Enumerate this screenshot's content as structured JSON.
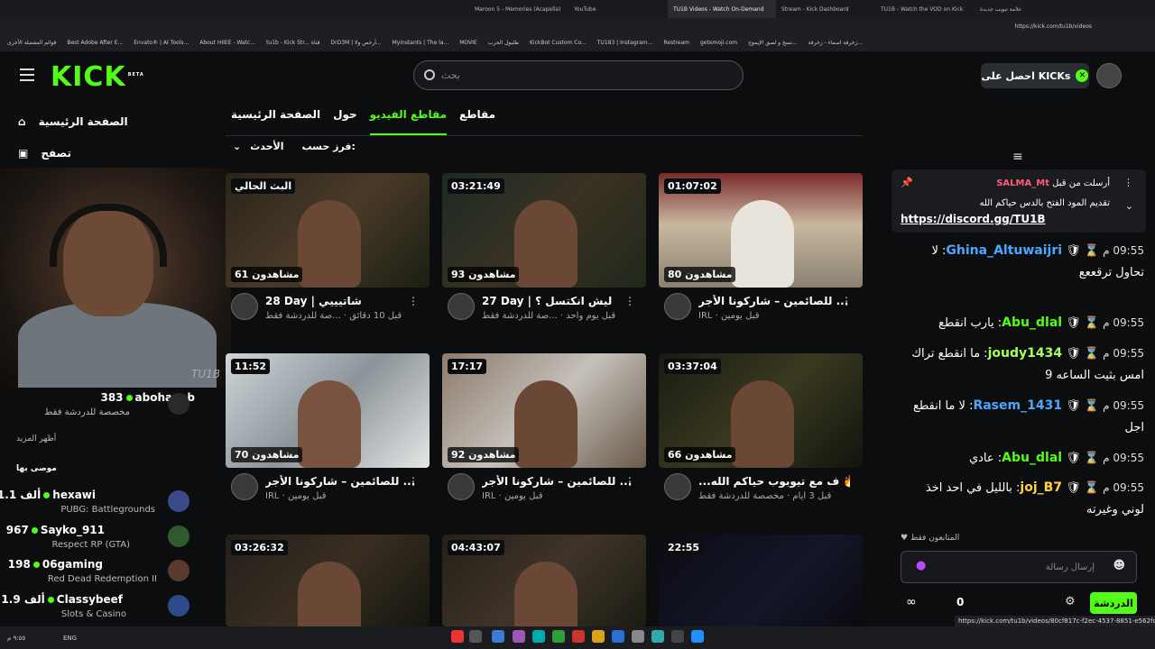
{
  "browser": {
    "tabs": [
      "Maroon 5 - Memories (Acapella)",
      "YouTube",
      "TU1B Videos - Watch On-Demand",
      "Stream - Kick Dashboard",
      "TU1B - Watch the VOD on Kick",
      "علامة تبويب جديدة"
    ],
    "url": "https://kick.com/tu1b/videos",
    "bookmarks": [
      "قوائم المفضلة الأخرى",
      "Best Adobe After E...",
      "Envato® | AI Tools...",
      "About HIIEE - Watc...",
      "tu1b - Kick Str... قناة",
      "DrD3M | أرخص ولا...",
      "Myinstants | The la...",
      "MOVIE",
      "طليول الحرب",
      "KickBot Custom Co...",
      "TU183 | Instagram...",
      "Restream",
      "getemoji.com",
      "نسخ و لصق الإيموج...",
      "زخرفة اسماء - زخرفة..."
    ]
  },
  "header": {
    "logo": "KICK",
    "logo_badge": "BETA",
    "search_placeholder": "بحث",
    "get_kicks": "احصل على KICKs"
  },
  "sidebar": {
    "nav": [
      "الصفحة الرئيسية",
      "تصفح"
    ],
    "stream_label": "TU1B",
    "current": {
      "name": "abohaeeb",
      "count": "383",
      "category": "مخصصة للدردشة فقط"
    },
    "show_more": "أظهر المزيد",
    "recommended_label": "موصى بها",
    "channels": [
      {
        "name": "hexawi",
        "count": "1.1 ألف",
        "category": "PUBG: Battlegrounds"
      },
      {
        "name": "Sayko_911",
        "count": "967",
        "category": "Respect RP (GTA)"
      },
      {
        "name": "06gaming",
        "count": "198",
        "category": "Red Dead Redemption II"
      },
      {
        "name": "Classybeef",
        "count": "1.9 ألف",
        "category": "Slots & Casino"
      }
    ]
  },
  "main": {
    "tabs": [
      "الصفحة الرئيسية",
      "حول",
      "مقاطع الفيديو",
      "مقاطع"
    ],
    "sort_label": "فرز حسب:",
    "sort_value": "الأحدث",
    "videos": [
      {
        "duration": "البث الحالي",
        "views": "61 مشاهدون",
        "title": "28 Day | شاتيييي",
        "sub": "قبل 10 دقائق · ...صة للدردشة فقط"
      },
      {
        "duration": "03:21:49",
        "views": "93 مشاهدون",
        "title": "27 Day | ليش انكتسل ؟",
        "sub": "قبل يوم واحد · ...صة للدردشة فقط"
      },
      {
        "duration": "01:07:02",
        "views": "80 مشاهدون",
        "title": "للصائمين – شاركونا الأجر ...",
        "sub": "IRL · قبل يومين"
      },
      {
        "duration": "11:52",
        "views": "70 مشاهدون",
        "title": "للصائمين – شاركونا الأجر ...",
        "sub": "IRL · قبل يومين"
      },
      {
        "duration": "17:17",
        "views": "92 مشاهدون",
        "title": "للصائمين – شاركونا الأجر ...",
        "sub": "IRL · قبل يومين"
      },
      {
        "duration": "03:37:04",
        "views": "66 مشاهدون",
        "title": "...ف مع تيوبوب حياكم الله 🔥",
        "sub": "قبل 3 أيام · مخصصة للدردشة فقط"
      },
      {
        "duration": "03:26:32",
        "views": "",
        "title": "",
        "sub": ""
      },
      {
        "duration": "04:43:07",
        "views": "",
        "title": "",
        "sub": ""
      },
      {
        "duration": "22:55",
        "views": "",
        "title": "",
        "sub": ""
      }
    ]
  },
  "chat": {
    "pinned_user": "SALMA_Mt",
    "pinned_by": "أرسلت من قبل",
    "pinned_text": "تقديم المود الفتح بالدس حياكم الله",
    "pinned_link": "https://discord.gg/TU1B",
    "messages": [
      {
        "time": "09:55 م",
        "user": "Ghina_Altuwaijri",
        "color": "#4aa8ff",
        "text": "لا تحاول ترقععع"
      },
      {
        "time": "09:55 م",
        "user": "Abu_dlal",
        "color": "#53fc18",
        "text": "يارب انقطع"
      },
      {
        "time": "09:55 م",
        "user": "joudy1434",
        "color": "#a7ff5a",
        "text": "ما انقطع تراك امس بثيت الساعه 9"
      },
      {
        "time": "09:55 م",
        "user": "Rasem_1431",
        "color": "#4aa8ff",
        "text": "لا ما انقطع اجل"
      },
      {
        "time": "09:55 م",
        "user": "Abu_dlal",
        "color": "#53fc18",
        "text": "عادي"
      },
      {
        "time": "09:55 م",
        "user": "joj_B7",
        "color": "#ffd33d",
        "text": "بالليل في احد اخذ لوني وغيرته"
      }
    ],
    "followers_only": "المتابعون فقط",
    "placeholder": "إرسال رسالة",
    "count": "0",
    "send_label": "الدردشة"
  },
  "status_url": "https://kick.com/tu1b/videos/80cf817c-f2ec-4537-8851-e562fca40f48",
  "taskbar": {
    "lang": "ENG",
    "date": "١٤٤٥/٩/٢٨",
    "time": "٩:٥٥ م"
  }
}
